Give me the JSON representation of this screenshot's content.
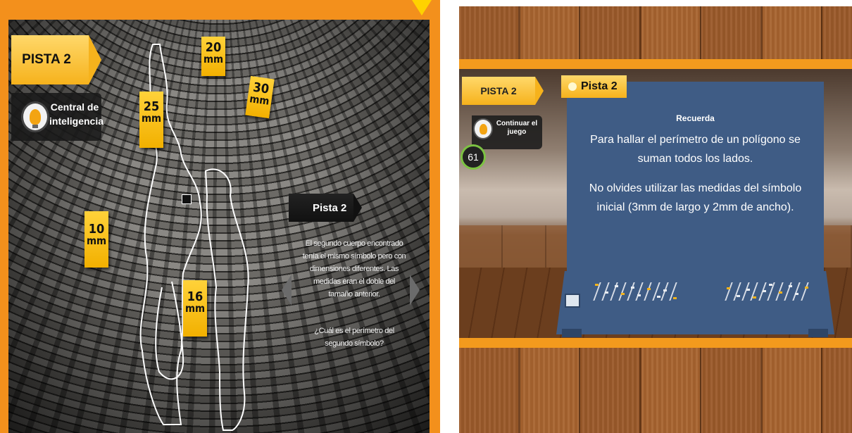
{
  "left": {
    "pista_tab": "PISTA 2",
    "central_line1": "Central de",
    "central_line2": "inteligencia",
    "markers": [
      {
        "num": "20",
        "unit": "mm"
      },
      {
        "num": "30",
        "unit": "mm"
      },
      {
        "num": "25",
        "unit": "mm"
      },
      {
        "num": "10",
        "unit": "mm"
      },
      {
        "num": "16",
        "unit": "mm"
      }
    ],
    "clue_title": "Pista 2",
    "clue_text": "El segundo cuerpo encontrado tenía el mismo símbolo pero con dimensiones diferentes. Las medidas eran el doble del tamaño anterior.",
    "clue_question": "¿Cuál es el perímetro del segundo símbolo?"
  },
  "right": {
    "pista_tab": "PISTA 2",
    "continue_label": "Continuar el juego",
    "timer": "61",
    "board_tab": "Pista 2",
    "board_title": "Recuerda",
    "board_text1": "Para hallar el perímetro de un polígono se suman todos los lados.",
    "board_text2": "No olvides utilizar las medidas del símbolo inicial (3mm de largo y 2mm de ancho)."
  },
  "colors": {
    "frame_orange": "#f3901c",
    "tab_yellow": "#f6b21c",
    "board_blue": "#3f5c85",
    "timer_green": "#7cc242"
  }
}
